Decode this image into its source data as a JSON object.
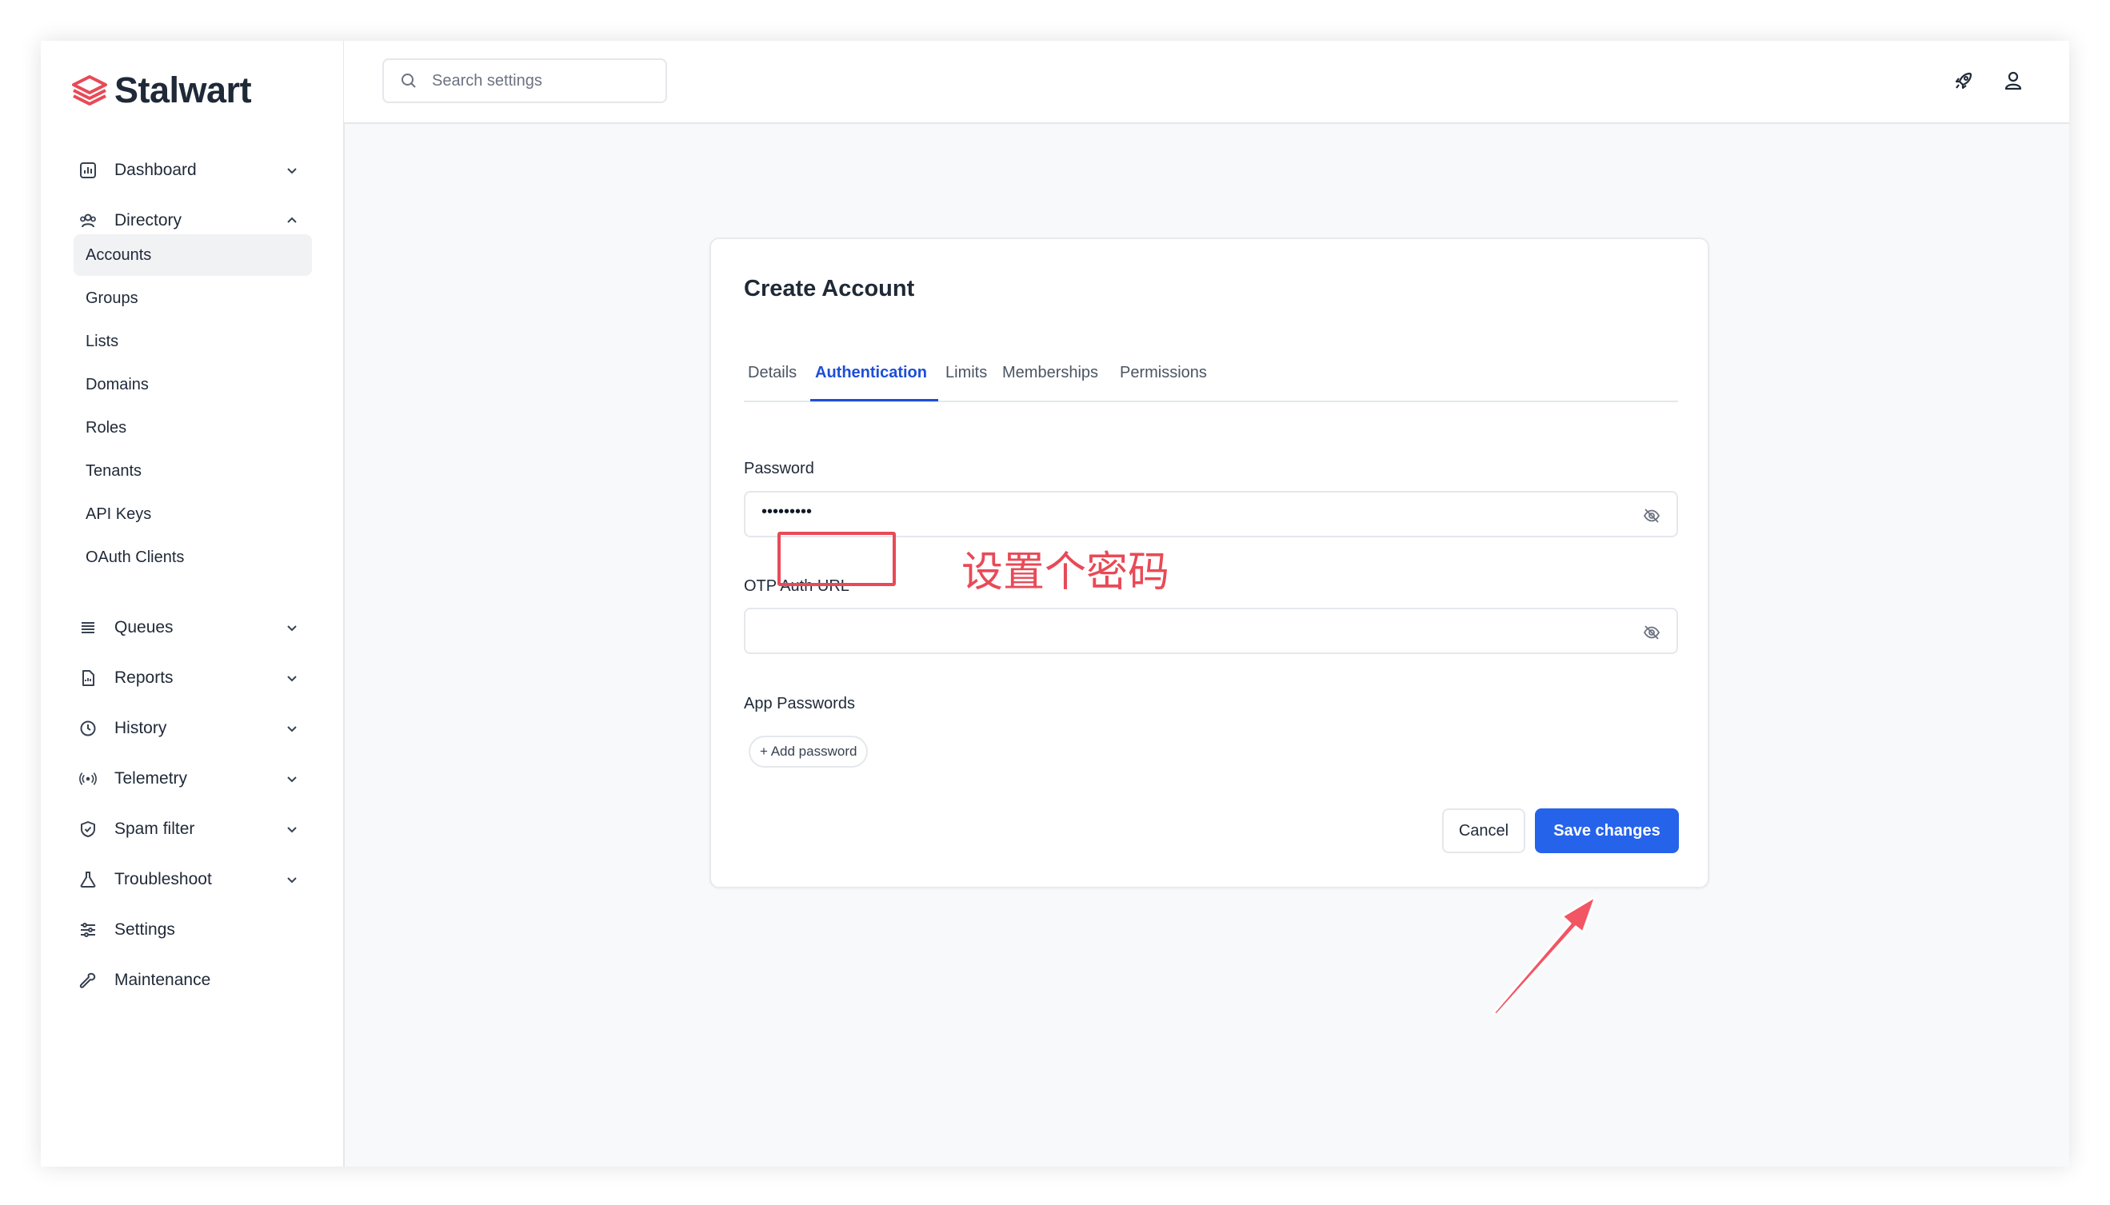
{
  "brand": {
    "name": "Stalwart",
    "accent": "#e84a57"
  },
  "sidebar": {
    "top_items": [
      {
        "label": "Dashboard",
        "icon": "dashboard-icon",
        "expanded": false
      },
      {
        "label": "Directory",
        "icon": "directory-icon",
        "expanded": true
      },
      {
        "label": "Queues",
        "icon": "queues-icon",
        "expanded": false
      },
      {
        "label": "Reports",
        "icon": "reports-icon",
        "expanded": false
      },
      {
        "label": "History",
        "icon": "history-icon",
        "expanded": false
      },
      {
        "label": "Telemetry",
        "icon": "telemetry-icon",
        "expanded": false
      },
      {
        "label": "Spam filter",
        "icon": "shield-icon",
        "expanded": false
      },
      {
        "label": "Troubleshoot",
        "icon": "troubleshoot-icon",
        "expanded": false
      },
      {
        "label": "Settings",
        "icon": "settings-icon"
      },
      {
        "label": "Maintenance",
        "icon": "wrench-icon"
      }
    ],
    "directory_items": [
      "Accounts",
      "Groups",
      "Lists",
      "Domains",
      "Roles",
      "Tenants",
      "API Keys",
      "OAuth Clients"
    ],
    "active_item": "Accounts"
  },
  "header": {
    "search_placeholder": "Search settings",
    "icons": [
      "rocket-icon",
      "user-icon"
    ]
  },
  "form": {
    "title": "Create Account",
    "tabs": [
      {
        "label": "Details",
        "active": false
      },
      {
        "label": "Authentication",
        "active": true
      },
      {
        "label": "Limits",
        "active": false
      },
      {
        "label": "Memberships",
        "active": false
      },
      {
        "label": "Permissions",
        "active": false
      }
    ],
    "password_label": "Password",
    "password_value": "•••••••••",
    "otp_label": "OTP Auth URL",
    "otp_value": "",
    "app_passwords_label": "App Passwords",
    "add_password_label": "+ Add password",
    "cancel_label": "Cancel",
    "save_label": "Save changes",
    "primary_color": "#2563eb"
  },
  "annotation": {
    "text": "设置个密码",
    "color": "#e84a57"
  }
}
